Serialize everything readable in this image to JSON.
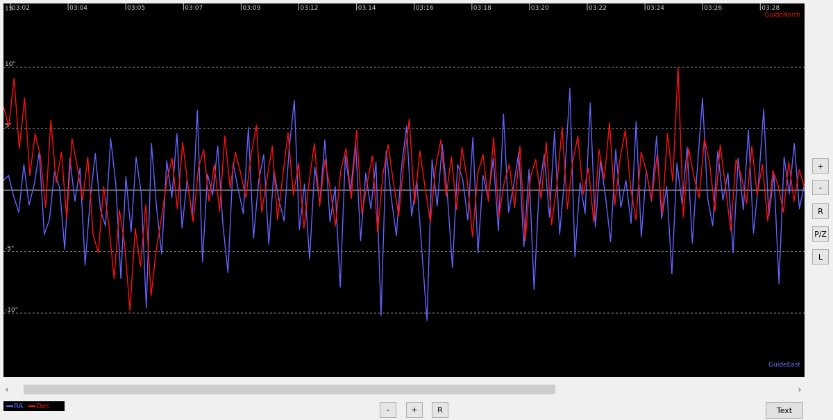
{
  "chart_data": {
    "type": "line",
    "x_ticks": [
      "03:02",
      "03:04",
      "03:05",
      "03:07",
      "03:09",
      "03:12",
      "03:14",
      "03:16",
      "03:18",
      "03:20",
      "03:22",
      "03:24",
      "03:26",
      "03:28"
    ],
    "y_ticks": [
      {
        "value": 10,
        "label": "10\""
      },
      {
        "value": 5,
        "label": "5\""
      },
      {
        "value": -5,
        "label": "-5\""
      },
      {
        "value": -10,
        "label": "-10\""
      }
    ],
    "top_tick_label": "15",
    "ylim": [
      -15,
      15
    ],
    "grid": true,
    "series": [
      {
        "name": "RA",
        "color": "#6464ff",
        "values": [
          0.8,
          1.2,
          -0.5,
          -1.8,
          2.1,
          -1.2,
          0.4,
          3.1,
          -3.6,
          -2.4,
          1.5,
          0.2,
          -4.8,
          2.6,
          -0.9,
          1.8,
          -6.1,
          -0.7,
          3.0,
          -1.6,
          -2.9,
          4.2,
          0.6,
          -7.2,
          1.1,
          -3.4,
          2.7,
          -0.3,
          -9.6,
          3.8,
          -1.4,
          -5.2,
          2.4,
          -0.6,
          4.6,
          -3.1,
          0.9,
          -2.2,
          6.5,
          -5.8,
          1.3,
          -0.4,
          3.6,
          -2.8,
          -6.7,
          2.2,
          0.1,
          -1.9,
          5.1,
          -3.9,
          0.7,
          2.9,
          -4.4,
          1.6,
          -0.8,
          -2.5,
          3.4,
          7.3,
          -3.2,
          0.5,
          -5.6,
          1.9,
          -1.1,
          4.1,
          -2.6,
          0.3,
          -7.9,
          2.8,
          -0.2,
          3.9,
          -4.1,
          1.4,
          -1.5,
          2.3,
          -10.2,
          3.2,
          -0.6,
          -3.7,
          1.8,
          5.2,
          -2.1,
          0.8,
          -4.9,
          -10.6,
          2.5,
          -1.3,
          3.7,
          -0.4,
          -6.3,
          2.1,
          0.9,
          -2.4,
          4.3,
          -5.1,
          1.2,
          -0.7,
          2.6,
          -3.3,
          6.2,
          -1.8,
          0.4,
          3.1,
          -4.6,
          1.7,
          -8.1,
          0.2,
          2.9,
          -2.2,
          4.8,
          -3.6,
          1.1,
          8.3,
          -5.4,
          0.6,
          -1.9,
          7.1,
          -3.0,
          2.4,
          -0.5,
          -4.2,
          3.3,
          -1.4,
          0.8,
          -2.7,
          5.6,
          -3.8,
          1.6,
          -0.9,
          4.4,
          -2.3,
          0.3,
          -6.8,
          2.2,
          -1.1,
          3.5,
          -4.3,
          1.8,
          7.5,
          -0.6,
          -2.9,
          3.2,
          -0.8,
          1.4,
          -5.1,
          2.6,
          -1.6,
          4.9,
          -3.5,
          0.7,
          6.6,
          -2.1,
          1.3,
          -7.6,
          2.7,
          -0.3,
          3.8,
          -1.5,
          0.5
        ]
      },
      {
        "name": "Dec",
        "color": "#ff1010",
        "values": [
          6.8,
          5.2,
          9.1,
          3.4,
          7.5,
          1.2,
          4.6,
          2.8,
          -1.4,
          5.7,
          0.6,
          3.1,
          -2.3,
          4.2,
          1.9,
          -0.8,
          2.7,
          -3.6,
          -5.1,
          0.3,
          -2.8,
          -7.2,
          -1.6,
          -4.4,
          -9.8,
          -3.1,
          -6.2,
          -1.2,
          -8.6,
          -4.8,
          -2.2,
          0.8,
          2.6,
          -1.5,
          3.9,
          0.4,
          -2.6,
          1.8,
          3.3,
          -0.9,
          2.1,
          -1.7,
          4.4,
          0.2,
          3.1,
          1.4,
          -0.6,
          2.9,
          5.3,
          -1.8,
          0.9,
          3.6,
          -2.4,
          1.2,
          4.7,
          -0.4,
          2.2,
          -3.1,
          0.7,
          3.8,
          -1.3,
          2.5,
          0.1,
          -2.9,
          1.6,
          3.4,
          -0.7,
          4.9,
          -1.9,
          0.5,
          2.8,
          -3.4,
          1.3,
          3.7,
          0.6,
          -2.1,
          2.4,
          5.8,
          -1.1,
          3.2,
          0.2,
          -2.6,
          1.9,
          4.1,
          -0.5,
          2.7,
          -1.6,
          3.5,
          0.8,
          -3.8,
          1.4,
          2.9,
          -0.9,
          4.3,
          -2.2,
          0.6,
          2.1,
          -1.4,
          3.6,
          -4.1,
          1.1,
          2.5,
          -0.7,
          3.9,
          -2.8,
          0.4,
          5.1,
          -1.5,
          2.3,
          4.4,
          -0.3,
          1.8,
          -2.6,
          3.3,
          0.9,
          5.5,
          -1.2,
          2.6,
          4.9,
          0.2,
          -2.4,
          3.1,
          1.5,
          -0.8,
          2.8,
          -1.9,
          4.6,
          0.7,
          10.0,
          -2.2,
          3.4,
          1.1,
          -0.6,
          4.2,
          2.2,
          -1.7,
          3.7,
          0.3,
          -3.3,
          2.5,
          1.2,
          -1.1,
          3.6,
          -0.4,
          2.1,
          -2.5,
          1.6,
          0.4,
          -1.8,
          2.3,
          -0.9,
          1.7,
          0.2
        ]
      }
    ]
  },
  "labels": {
    "north": "GuideNorth",
    "east": "GuideEast"
  },
  "side_buttons": [
    "+",
    "-",
    "R",
    "P/Z",
    "L"
  ],
  "bottom_buttons": [
    "-",
    "+",
    "R"
  ],
  "text_button": "Text",
  "scroll": {
    "left_arrow": "‹",
    "right_arrow": "›"
  },
  "legend": {
    "ra": "RA",
    "dec": "Dec",
    "ra_color": "#6464ff",
    "dec_color": "#ff1010"
  }
}
